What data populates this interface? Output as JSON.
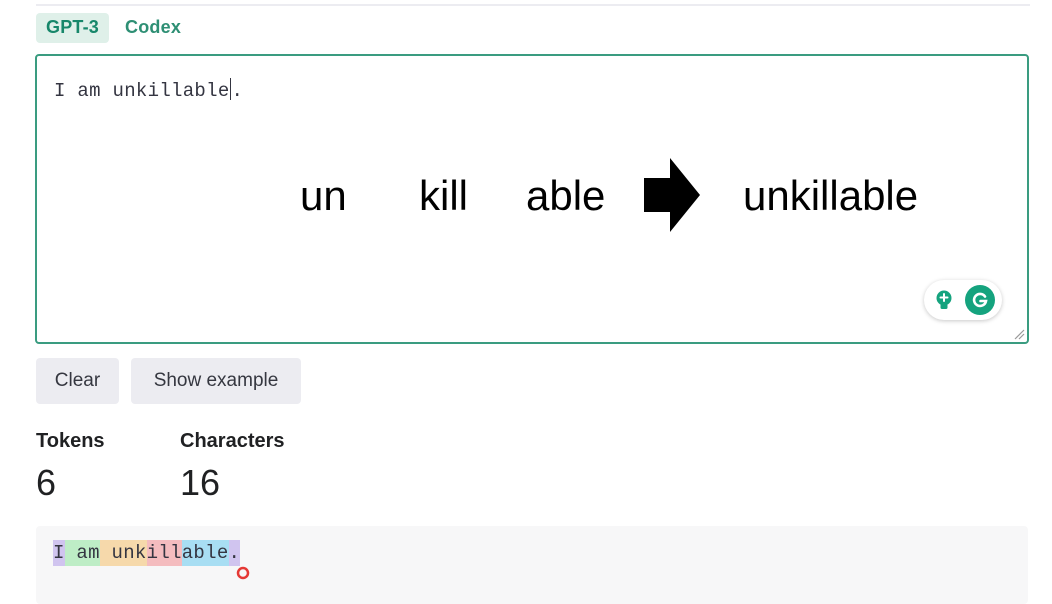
{
  "tabs": [
    {
      "label": "GPT-3",
      "active": true
    },
    {
      "label": "Codex",
      "active": false
    }
  ],
  "editor": {
    "text_before_caret": "I am unkillable",
    "text_after_caret": "."
  },
  "annotation": {
    "parts": [
      "un",
      "kill",
      "able"
    ],
    "result": "unkillable"
  },
  "buttons": {
    "clear": "Clear",
    "show_example": "Show example"
  },
  "stats": {
    "tokens_label": "Tokens",
    "tokens_value": "6",
    "characters_label": "Characters",
    "characters_value": "16"
  },
  "tokenized": {
    "tokens": [
      "I",
      " am",
      " unk",
      "ill",
      "able",
      "."
    ]
  },
  "colors": {
    "accent": "#10a37f",
    "editor_border": "#3a9c80",
    "button_bg": "#ececf1",
    "token_box_bg": "#f7f7f8"
  }
}
